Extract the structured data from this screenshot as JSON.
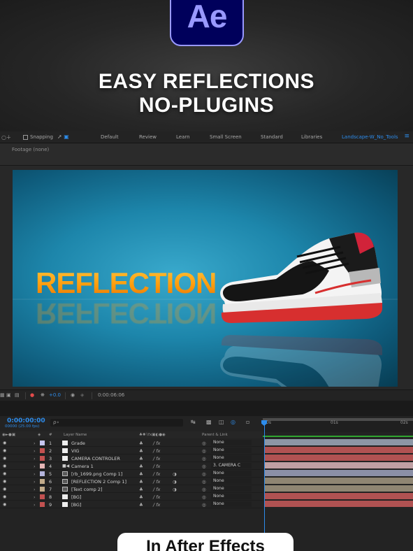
{
  "hero": {
    "logo_text": "Ae",
    "title_line1": "EASY REFLECTIONS",
    "title_line2": "NO-PLUGINS"
  },
  "workspace": {
    "snapping_label": "Snapping",
    "items": [
      "Default",
      "Review",
      "Learn",
      "Small Screen",
      "Standard",
      "Libraries",
      "Landscape-W_No_Tools"
    ],
    "active": "Landscape-W_No_Tools",
    "menu_icon": "hamburger-icon"
  },
  "footage": {
    "label": "Footage (none)"
  },
  "composition": {
    "text": "REFLECTION",
    "text_color": "#ffa319",
    "bg_color": "#1d86ab"
  },
  "viewer_controls": {
    "exposure": "+0.0",
    "timecode": "0:00:06:06"
  },
  "timeline": {
    "timecode": "0:00:00:00",
    "frame_info": "00000 (25.00 fps)",
    "search_placeholder": "ρ∘",
    "ruler": [
      "0s",
      "01s",
      "02s"
    ],
    "columns": {
      "label": "#",
      "layer_name": "Layer Name",
      "parent": "Parent & Link"
    },
    "layers": [
      {
        "num": "1",
        "name": "Grade",
        "label_color": "#c6c6f0",
        "icon": "solid",
        "parent": "None",
        "bar": "#8d97a6"
      },
      {
        "num": "2",
        "name": "VIG",
        "label_color": "#c25150",
        "icon": "solid",
        "parent": "None",
        "bar": "#b05252"
      },
      {
        "num": "3",
        "name": "CAMERA CONTROLER",
        "label_color": "#c25150",
        "icon": "solid",
        "parent": "None",
        "bar": "#b05252"
      },
      {
        "num": "4",
        "name": "Camera 1",
        "label_color": "#e6b6b6",
        "icon": "camera",
        "parent": "3. CAMERA C",
        "bar": "#bfa0a3"
      },
      {
        "num": "5",
        "name": "[rb_1699.png Comp 1]",
        "label_color": "#b4b4dc",
        "icon": "comp",
        "parent": "None",
        "bar": "#8b8fa6"
      },
      {
        "num": "6",
        "name": "[REFLECTION 2 Comp 1]",
        "label_color": "#c2ab8a",
        "icon": "comp",
        "parent": "None",
        "bar": "#8f8572"
      },
      {
        "num": "7",
        "name": "[Text comp 2]",
        "label_color": "#c2ab8a",
        "icon": "comp",
        "parent": "None",
        "bar": "#8f8572"
      },
      {
        "num": "8",
        "name": "[BG]",
        "label_color": "#c25150",
        "icon": "solid",
        "parent": "None",
        "bar": "#b05252"
      },
      {
        "num": "9",
        "name": "[BG]",
        "label_color": "#c25150",
        "icon": "solid",
        "parent": "None",
        "bar": "#b05252"
      }
    ]
  },
  "pill": {
    "text": "In After Effects"
  }
}
